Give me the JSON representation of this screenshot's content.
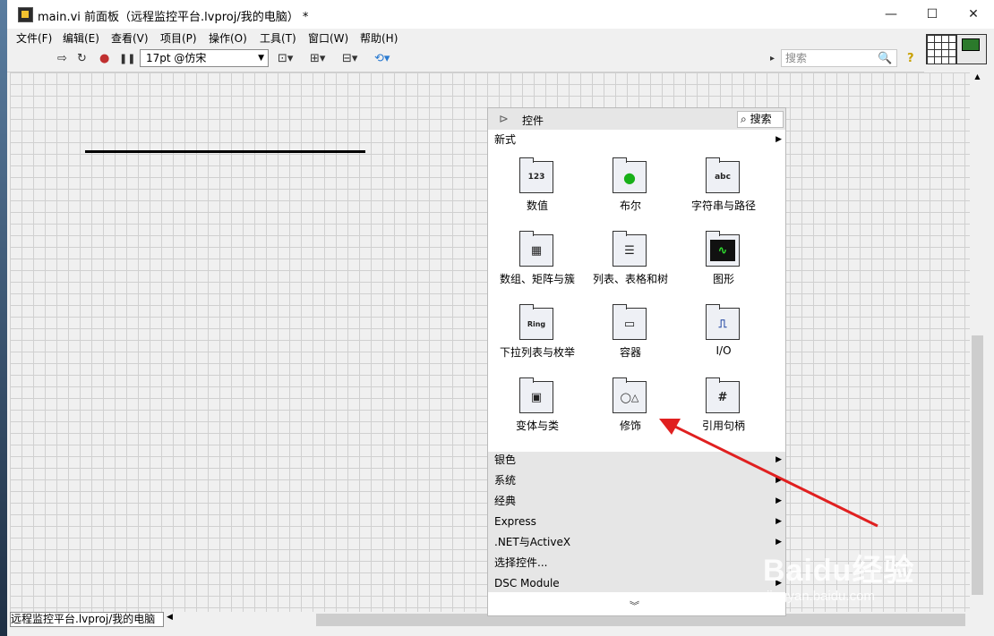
{
  "window": {
    "title": "main.vi 前面板（远程监控平台.lvproj/我的电脑） *",
    "minimize": "—",
    "maximize": "☐",
    "close": "✕"
  },
  "menubar": {
    "items": [
      "文件(F)",
      "编辑(E)",
      "查看(V)",
      "项目(P)",
      "操作(O)",
      "工具(T)",
      "窗口(W)",
      "帮助(H)"
    ]
  },
  "toolbar": {
    "font": "17pt @仿宋",
    "search_placeholder": "搜索",
    "icons": {
      "run": "⇨",
      "run_continuous": "↻",
      "abort": "●",
      "pause": "❚❚",
      "align": "⊡▾",
      "distribute": "⊞▾",
      "resize": "⊟▾",
      "reorder": "⟲▾",
      "help": "?",
      "search": "🔍",
      "panel_arrow": "▸"
    }
  },
  "palette": {
    "title": "控件",
    "search_label": "搜索",
    "header_category": "新式",
    "items": [
      {
        "label": "数值",
        "icon": "numeric-icon",
        "glyph": "123"
      },
      {
        "label": "布尔",
        "icon": "boolean-icon",
        "glyph": "●"
      },
      {
        "label": "字符串与路径",
        "icon": "string-path-icon",
        "glyph": "abc"
      },
      {
        "label": "数组、矩阵与簇",
        "icon": "array-matrix-cluster-icon",
        "glyph": "▦"
      },
      {
        "label": "列表、表格和树",
        "icon": "list-table-tree-icon",
        "glyph": "☰"
      },
      {
        "label": "图形",
        "icon": "graph-icon",
        "glyph": "∿"
      },
      {
        "label": "下拉列表与枚举",
        "icon": "ring-enum-icon",
        "glyph": "Ring"
      },
      {
        "label": "容器",
        "icon": "containers-icon",
        "glyph": "▭"
      },
      {
        "label": "I/O",
        "icon": "io-icon",
        "glyph": "⎍"
      },
      {
        "label": "变体与类",
        "icon": "variant-class-icon",
        "glyph": "▣"
      },
      {
        "label": "修饰",
        "icon": "decorations-icon",
        "glyph": "◯△"
      },
      {
        "label": "引用句柄",
        "icon": "refnum-icon",
        "glyph": "#"
      }
    ],
    "categories": [
      "银色",
      "系统",
      "经典",
      "Express",
      ".NET与ActiveX",
      "选择控件...",
      "DSC Module"
    ],
    "more": "︾"
  },
  "statusbar": {
    "text": "远程监控平台.lvproj/我的电脑"
  },
  "watermark": {
    "main": "Baidu经验",
    "sub": "jingyan.baidu.com"
  },
  "colors": {
    "arrow": "#e02020",
    "canvas": "#f0f0f0",
    "grid": "#d0d0d0"
  }
}
